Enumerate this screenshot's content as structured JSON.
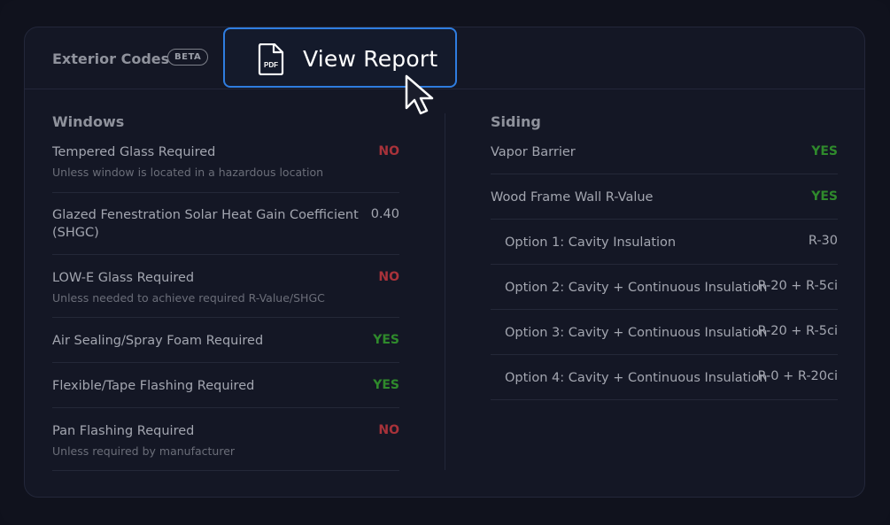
{
  "header": {
    "title": "Exterior Codes",
    "badge": "BETA",
    "view_report_label": "View Report",
    "pdf_icon_text": "PDF"
  },
  "colors": {
    "accent": "#2f7de0",
    "no": "#a8323a",
    "yes": "#2f8a2c",
    "background": "#10121d"
  },
  "windows": {
    "title": "Windows",
    "items": [
      {
        "label": "Tempered Glass Required",
        "sub": "Unless window is located in a hazardous location",
        "value": "NO"
      },
      {
        "label": "Glazed Fenestration Solar Heat Gain Coefficient",
        "label2": "(SHGC)",
        "value": "0.40"
      },
      {
        "label": "LOW-E Glass Required",
        "sub": "Unless needed to achieve required R-Value/SHGC",
        "value": "NO"
      },
      {
        "label": "Air Sealing/Spray Foam Required",
        "value": "YES"
      },
      {
        "label": "Flexible/Tape Flashing Required",
        "value": "YES"
      },
      {
        "label": "Pan Flashing Required",
        "sub": "Unless required by manufacturer",
        "value": "NO"
      }
    ]
  },
  "siding": {
    "title": "Siding",
    "items": [
      {
        "label": "Vapor Barrier",
        "value": "YES"
      },
      {
        "label": "Wood Frame Wall R-Value",
        "value": "YES"
      },
      {
        "label": "Option 1: Cavity Insulation",
        "value": "R-30"
      },
      {
        "label": "Option 2: Cavity + Continuous Insulation",
        "value": "R-20 + R-5ci"
      },
      {
        "label": "Option 3: Cavity + Continuous Insulation",
        "value": "R-20 + R-5ci"
      },
      {
        "label": "Option 4: Cavity + Continuous Insulation",
        "value": "R-0 + R-20ci"
      }
    ]
  }
}
